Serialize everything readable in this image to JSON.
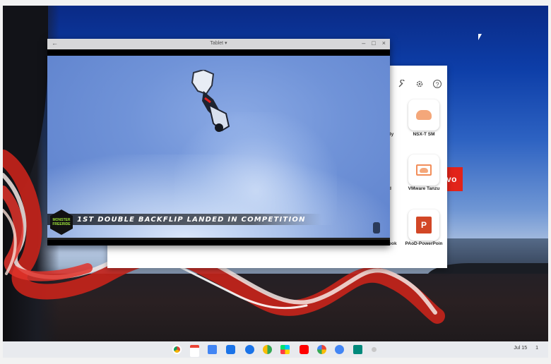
{
  "wallpaper": {
    "brand_badge": "vo"
  },
  "front_window": {
    "title": "Tablet ▾",
    "back_glyph": "←",
    "controls": [
      "–",
      "□",
      "×"
    ],
    "video": {
      "caption": "1ST DOUBLE BACKFLIP LANDED IN COMPETITION",
      "badge_text": "MONSTER FREERIDE"
    }
  },
  "back_window": {
    "toolbar_icons": [
      "link-icon",
      "wrench-icon",
      "gear-icon",
      "help-icon"
    ],
    "help_glyph": "?",
    "partial_labels": [
      "lly",
      "d",
      "ook"
    ],
    "apps": [
      {
        "label": "NSX-T SM",
        "icon": "cloud-icon"
      },
      {
        "label": "VMware Tanzu",
        "icon": "monitor-cloud-icon"
      },
      {
        "label": "PAoD-PowerPoin",
        "icon": "powerpoint-icon",
        "glyph": "P"
      }
    ]
  },
  "shelf": {
    "apps": [
      "chrome",
      "gmail",
      "docs",
      "files",
      "messages",
      "photos-gallery",
      "play-store",
      "youtube",
      "photos",
      "reminder",
      "meet",
      "app-dot"
    ],
    "date": "Jul 15",
    "time_partial": "1"
  }
}
